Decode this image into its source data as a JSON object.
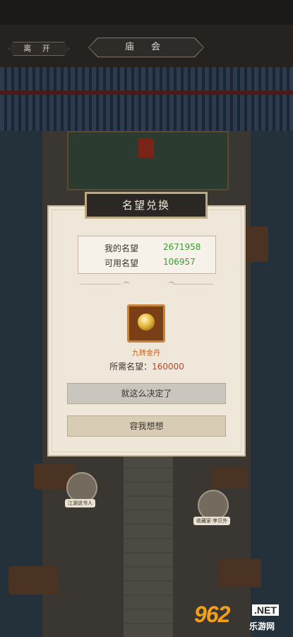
{
  "header": {
    "leave_label": "离 开",
    "location_title": "庙 会"
  },
  "dialog": {
    "title": "名望兑换",
    "stats": [
      {
        "label": "我的名望",
        "value": "2671958"
      },
      {
        "label": "可用名望",
        "value": "106957"
      }
    ],
    "item_name": "九转金丹",
    "requirement_label": "所需名望：",
    "requirement_value": "160000",
    "confirm_label": "就这么决定了",
    "cancel_label": "容我想想"
  },
  "npcs": [
    {
      "name": "江湖说书人"
    },
    {
      "name": "收藏家·李贝外"
    }
  ],
  "watermark": {
    "number": "962",
    "suffix": ".NET",
    "site": "乐游网"
  },
  "colors": {
    "accent_green": "#3a9c2e",
    "accent_red": "#c0452a",
    "item_orange": "#c2611b"
  }
}
